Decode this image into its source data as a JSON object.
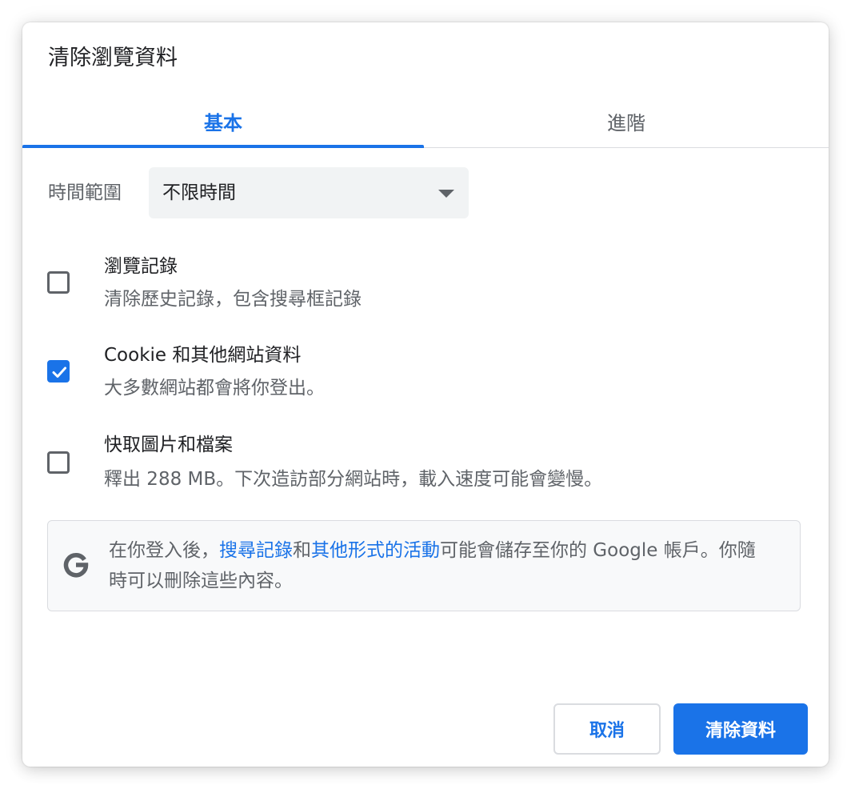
{
  "dialog": {
    "title": "清除瀏覽資料"
  },
  "tabs": [
    {
      "label": "基本",
      "selected": true
    },
    {
      "label": "進階",
      "selected": false
    }
  ],
  "time_range": {
    "label": "時間範圍",
    "selected": "不限時間"
  },
  "options": [
    {
      "title": "瀏覽記錄",
      "description": "清除歷史記錄，包含搜尋框記錄",
      "checked": false
    },
    {
      "title": "Cookie 和其他網站資料",
      "description": "大多數網站都會將你登出。",
      "checked": true
    },
    {
      "title": "快取圖片和檔案",
      "description": "釋出 288 MB。下次造訪部分網站時，載入速度可能會變慢。",
      "checked": false
    }
  ],
  "info": {
    "icon": "google-g-icon",
    "text_before": "在你登入後，",
    "link1": "搜尋記錄",
    "text_middle": "和",
    "link2": "其他形式的活動",
    "text_after": "可能會儲存至你的 Google 帳戶。你隨時可以刪除這些內容。"
  },
  "buttons": {
    "cancel": "取消",
    "confirm": "清除資料"
  },
  "colors": {
    "accent": "#1a73e8",
    "text_primary": "#202124",
    "text_secondary": "#5f6368"
  }
}
